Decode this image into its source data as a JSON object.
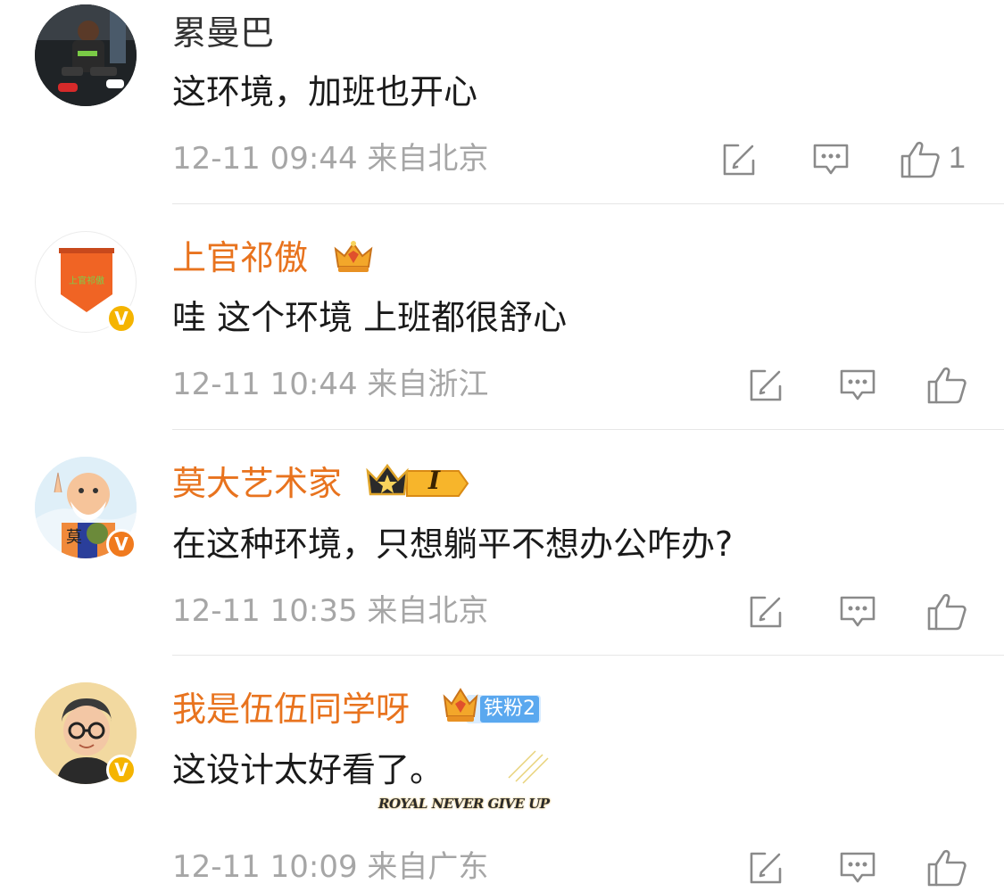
{
  "comments": [
    {
      "username": "累曼巴",
      "text": "这环境，加班也开心",
      "timestamp": "12-11 09:44",
      "location": "来自北京",
      "likes": "1",
      "verified": false,
      "vip": false
    },
    {
      "username": "上官祁傲",
      "avatar_text": "上官祁傲",
      "text": "哇 这个环境 上班都很舒心",
      "timestamp": "12-11 10:44",
      "location": "来自浙江",
      "likes": "",
      "verified": true,
      "verified_color": "#f5b400",
      "vip": true
    },
    {
      "username": "莫大艺术家",
      "avatar_text": "莫",
      "text": "在这种环境，只想躺平不想办公咋办?",
      "timestamp": "12-11 10:35",
      "location": "来自北京",
      "likes": "",
      "verified": true,
      "verified_color": "#f07a1e",
      "vip": true,
      "level_badge": "I"
    },
    {
      "username": "我是伍伍同学呀",
      "text": "这设计太好看了。",
      "timestamp": "12-11 10:09",
      "location": "来自广东",
      "likes": "",
      "verified": true,
      "verified_color": "#f5b400",
      "vip": true,
      "fan_badge": "铁粉2",
      "decoration_text": "ROYAL NEVER GIVE UP"
    }
  ],
  "colors": {
    "vip_name": "#e8731e",
    "meta": "#a6a6a6",
    "icon": "#8a8a8a"
  }
}
